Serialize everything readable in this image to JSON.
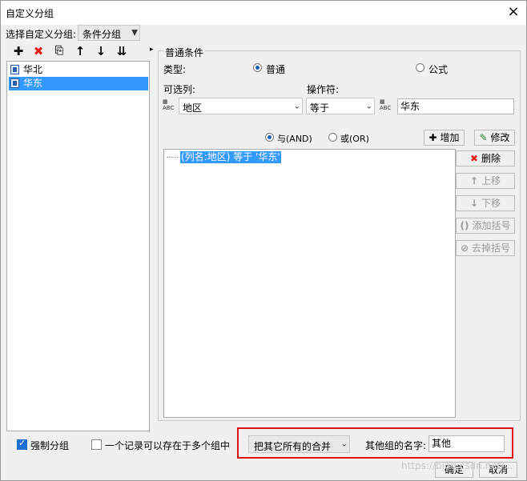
{
  "window": {
    "title": "自定义分组",
    "close_glyph": "×"
  },
  "group_select": {
    "label": "选择自定义分组:",
    "value": "条件分组"
  },
  "toolbar": [
    "add-icon",
    "delete-icon",
    "copy-icon",
    "move-up-icon",
    "move-down-icon",
    "sort-icon"
  ],
  "tree": {
    "items": [
      {
        "label": "华北",
        "selected": false
      },
      {
        "label": "华东",
        "selected": true
      }
    ]
  },
  "condition": {
    "section_title": "普通条件",
    "type_label": "类型:",
    "type_normal": "普通",
    "type_formula": "公式",
    "optional_label": "可选列:",
    "operator_label": "操作符:",
    "column_value": "地区",
    "operator_value": "等于",
    "value_value": "华东",
    "and_label": "与(AND)",
    "or_label": "或(OR)",
    "add_button": "增加",
    "modify_button": "修改",
    "expression": "(列名:地区) 等于 '华东'"
  },
  "side_buttons": {
    "delete": "删除",
    "up": "上移",
    "down": "下移",
    "add_bracket": "添加括号",
    "remove_bracket": "去掉括号"
  },
  "bottom": {
    "force_group_label": "强制分组",
    "force_group_checked": true,
    "multi_group_label": "一个记录可以存在于多个组中",
    "multi_group_checked": false,
    "merge_select": "把其它所有的合并",
    "other_name_label": "其他组的名字:",
    "other_name_value": "其他",
    "ok_button": "确定",
    "cancel_button": "取消"
  },
  "watermark": "https://blog.csdn.net/...",
  "colors": {
    "selection": "#3399ff",
    "highlight_border": "#e01010",
    "accent": "#1e6fd8"
  }
}
